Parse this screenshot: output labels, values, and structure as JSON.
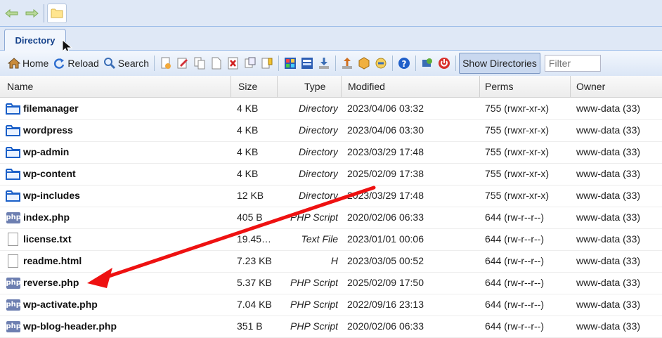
{
  "toolbar": {
    "home_label": "Home",
    "reload_label": "Reload",
    "search_label": "Search",
    "show_directories_label": "Show Directories",
    "filter_placeholder": "Filter"
  },
  "tab": {
    "label": "Directory"
  },
  "columns": {
    "name": "Name",
    "size": "Size",
    "type": "Type",
    "modified": "Modified",
    "perms": "Perms",
    "owner": "Owner"
  },
  "rows": [
    {
      "name": "filemanager",
      "size": "4 KB",
      "type": "Directory",
      "modified": "2023/04/06 03:32",
      "perms": "755 (rwxr-xr-x)",
      "owner": "www-data (33)",
      "icon": "folder-icon"
    },
    {
      "name": "wordpress",
      "size": "4 KB",
      "type": "Directory",
      "modified": "2023/04/06 03:30",
      "perms": "755 (rwxr-xr-x)",
      "owner": "www-data (33)",
      "icon": "folder-icon"
    },
    {
      "name": "wp-admin",
      "size": "4 KB",
      "type": "Directory",
      "modified": "2023/03/29 17:48",
      "perms": "755 (rwxr-xr-x)",
      "owner": "www-data (33)",
      "icon": "folder-icon"
    },
    {
      "name": "wp-content",
      "size": "4 KB",
      "type": "Directory",
      "modified": "2025/02/09 17:38",
      "perms": "755 (rwxr-xr-x)",
      "owner": "www-data (33)",
      "icon": "folder-icon"
    },
    {
      "name": "wp-includes",
      "size": "12 KB",
      "type": "Directory",
      "modified": "2023/03/29 17:48",
      "perms": "755 (rwxr-xr-x)",
      "owner": "www-data (33)",
      "icon": "folder-icon"
    },
    {
      "name": "index.php",
      "size": "405 B",
      "type": "PHP Script",
      "modified": "2020/02/06 06:33",
      "perms": "644 (rw-r--r--)",
      "owner": "www-data (33)",
      "icon": "php-icon"
    },
    {
      "name": "license.txt",
      "size": "19.45…",
      "type": "Text File",
      "modified": "2023/01/01 00:06",
      "perms": "644 (rw-r--r--)",
      "owner": "www-data (33)",
      "icon": "text-file-icon"
    },
    {
      "name": "readme.html",
      "size": "7.23 KB",
      "type": "H",
      "modified": "2023/03/05 00:52",
      "perms": "644 (rw-r--r--)",
      "owner": "www-data (33)",
      "icon": "html-file-icon"
    },
    {
      "name": "reverse.php",
      "size": "5.37 KB",
      "type": "PHP Script",
      "modified": "2025/02/09 17:50",
      "perms": "644 (rw-r--r--)",
      "owner": "www-data (33)",
      "icon": "php-icon"
    },
    {
      "name": "wp-activate.php",
      "size": "7.04 KB",
      "type": "PHP Script",
      "modified": "2022/09/16 23:13",
      "perms": "644 (rw-r--r--)",
      "owner": "www-data (33)",
      "icon": "php-icon"
    },
    {
      "name": "wp-blog-header.php",
      "size": "351 B",
      "type": "PHP Script",
      "modified": "2020/02/06 06:33",
      "perms": "644 (rw-r--r--)",
      "owner": "www-data (33)",
      "icon": "php-icon"
    }
  ],
  "php_badge": "php",
  "colors": {
    "accent": "#15428b",
    "annotation_arrow": "#ee1111",
    "folder": "#1a5fc8"
  }
}
